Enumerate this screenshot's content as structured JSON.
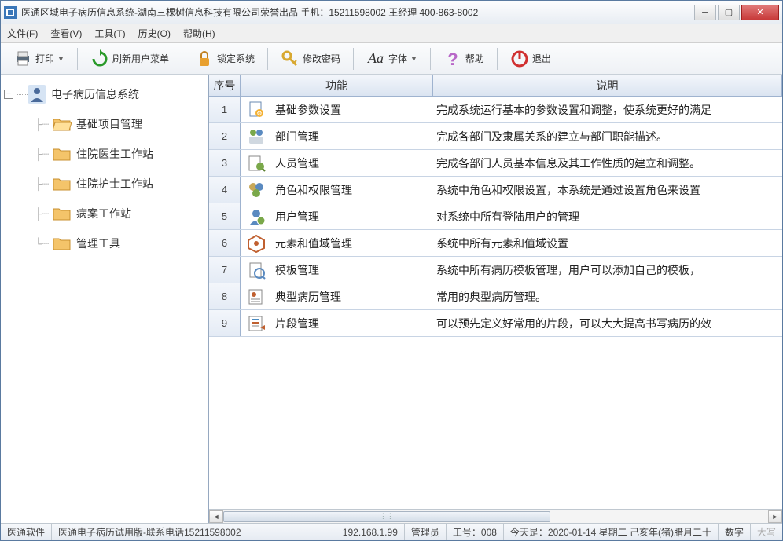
{
  "window": {
    "title": "医通区域电子病历信息系统-湖南三棵树信息科技有限公司荣誉出品 手机：15211598002 王经理 400-863-8002"
  },
  "menu": {
    "file": "文件(F)",
    "view": "查看(V)",
    "tools": "工具(T)",
    "history": "历史(O)",
    "help": "帮助(H)"
  },
  "toolbar": {
    "print": "打印",
    "refresh": "刷新用户菜单",
    "lock": "锁定系统",
    "password": "修改密码",
    "font": "字体",
    "help": "帮助",
    "exit": "退出"
  },
  "tree": {
    "root": "电子病历信息系统",
    "items": [
      "基础项目管理",
      "住院医生工作站",
      "住院护士工作站",
      "病案工作站",
      "管理工具"
    ]
  },
  "grid": {
    "headers": {
      "seq": "序号",
      "func": "功能",
      "desc": "说明"
    },
    "rows": [
      {
        "seq": "1",
        "func": "基础参数设置",
        "desc": "完成系统运行基本的参数设置和调整，使系统更好的满足"
      },
      {
        "seq": "2",
        "func": "部门管理",
        "desc": "完成各部门及隶属关系的建立与部门职能描述。"
      },
      {
        "seq": "3",
        "func": "人员管理",
        "desc": "完成各部门人员基本信息及其工作性质的建立和调整。"
      },
      {
        "seq": "4",
        "func": "角色和权限管理",
        "desc": "系统中角色和权限设置，本系统是通过设置角色来设置"
      },
      {
        "seq": "5",
        "func": "用户管理",
        "desc": "对系统中所有登陆用户的管理"
      },
      {
        "seq": "6",
        "func": "元素和值域管理",
        "desc": "系统中所有元素和值域设置"
      },
      {
        "seq": "7",
        "func": "模板管理",
        "desc": "系统中所有病历模板管理，用户可以添加自己的模板，"
      },
      {
        "seq": "8",
        "func": "典型病历管理",
        "desc": "常用的典型病历管理。"
      },
      {
        "seq": "9",
        "func": "片段管理",
        "desc": "可以预先定义好常用的片段，可以大大提高书写病历的效"
      }
    ]
  },
  "status": {
    "app": "医通软件",
    "version": "医通电子病历试用版-联系电话15211598002",
    "ip": "192.168.1.99",
    "user": "管理员",
    "workno": "工号：008",
    "date": "今天是：2020-01-14 星期二 己亥年(猪)腊月二十",
    "num": "数字",
    "caps": "大写"
  }
}
